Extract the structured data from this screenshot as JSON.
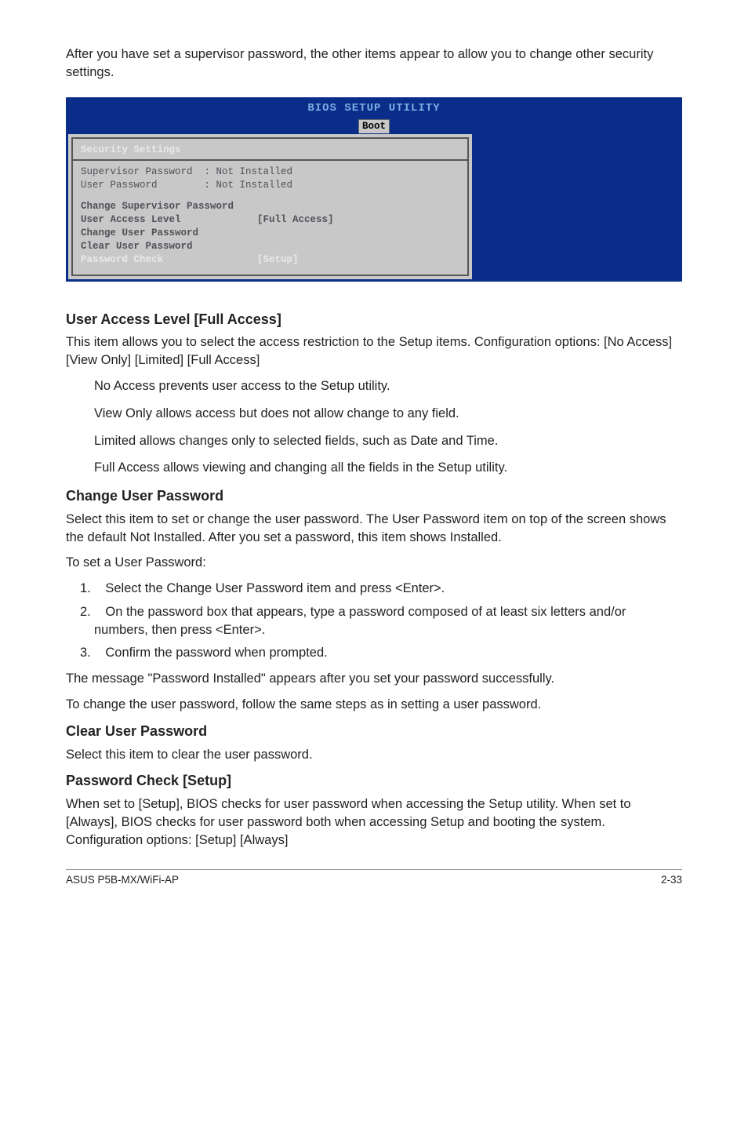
{
  "intro": "After you have set a supervisor password, the other items appear to allow you to change other security settings.",
  "bios": {
    "title": "BIOS SETUP UTILITY",
    "tab": "Boot",
    "section_title": "Security Settings",
    "sup_pass_row": "Supervisor Password  : Not Installed",
    "user_pass_row": "User Password        : Not Installed",
    "item_change_sup": "Change Supervisor Password",
    "item_user_access": "User Access Level             [Full Access]",
    "item_change_user": "Change User Password",
    "item_clear_user": "Clear User Password",
    "item_pass_check": "Password Check                [Setup]"
  },
  "h_user_access": "User Access Level [Full Access]",
  "p_user_access_1": "This item allows you to select the access restriction to the Setup items. Configuration options: [No Access] [View Only] [Limited] [Full Access]",
  "li_no_access": "No Access prevents user access to the Setup utility.",
  "li_view_only": "View Only allows access but does not allow change to any field.",
  "li_limited": "Limited allows changes only to selected fields, such as Date and Time.",
  "li_full": "Full Access allows viewing and changing all the fields in the Setup utility.",
  "h_change_user": "Change User Password",
  "p_change_user_1": "Select this item to set or change the user password. The User Password item on top of the screen shows the default Not Installed. After you set a password, this item shows Installed.",
  "p_to_set": "To set a User Password:",
  "ol1": "Select the Change User Password item and press <Enter>.",
  "ol2": "On the password box that appears, type a password composed of at least six letters and/or numbers, then press <Enter>.",
  "ol3": "Confirm the password when prompted.",
  "p_installed": "The message \"Password Installed\" appears after you set your password successfully.",
  "p_to_change": "To change the user password, follow the same steps as in setting a user password.",
  "h_clear_user": "Clear User Password",
  "p_clear_user": "Select this item to clear the user password.",
  "h_pass_check": "Password Check [Setup]",
  "p_pass_check": "When set to [Setup], BIOS checks for user password when accessing the Setup utility. When set to [Always], BIOS checks for user password both when accessing Setup and booting the system. Configuration options: [Setup] [Always]",
  "footer_left": "ASUS P5B-MX/WiFi-AP",
  "footer_right": "2-33"
}
